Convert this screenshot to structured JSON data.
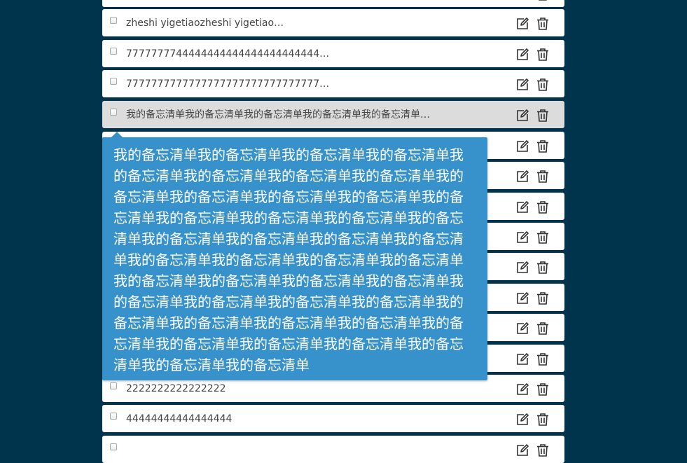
{
  "todo_items": [
    {
      "text": ""
    },
    {
      "text": "zheshi yigetiaozheshi yigetiao…"
    },
    {
      "text": "7777777744444444444444444444444…"
    },
    {
      "text": "7777777777777777777777777777777…"
    },
    {
      "text": "我的备忘清单我的备忘清单我的备忘清单我的备忘清单我的备忘清单…"
    },
    {
      "text": ""
    },
    {
      "text": ""
    },
    {
      "text": ""
    },
    {
      "text": ""
    },
    {
      "text": ""
    },
    {
      "text": ""
    },
    {
      "text": ""
    },
    {
      "text": ""
    },
    {
      "text": "2222222222222222"
    },
    {
      "text": "44444444444444444"
    },
    {
      "text": ""
    }
  ],
  "icons": {
    "edit": "edit-icon",
    "delete": "trash-icon",
    "checkbox": "checkbox"
  },
  "tooltip": {
    "text": "我的备忘清单我的备忘清单我的备忘清单我的备忘清单我的备忘清单我的备忘清单我的备忘清单我的备忘清单我的备忘清单我的备忘清单我的备忘清单我的备忘清单我的备忘清单我的备忘清单我的备忘清单我的备忘清单我的备忘清单我的备忘清单我的备忘清单我的备忘清单我的备忘清单我的备忘清单我的备忘清单我的备忘清单我的备忘清单我的备忘清单我的备忘清单我的备忘清单我的备忘清单我的备忘清单我的备忘清单我的备忘清单我的备忘清单我的备忘清单我的备忘清单我的备忘清单我的备忘清单我的备忘清单我的备忘清单我的备忘清单我的备忘清单我的备忘清单我的备忘清单我的备忘清单"
  },
  "colors": {
    "background": "#00344d",
    "row": "#ffffff",
    "row_hover": "#dcdcdc",
    "tooltip": "#3792cb",
    "text": "#444444"
  }
}
